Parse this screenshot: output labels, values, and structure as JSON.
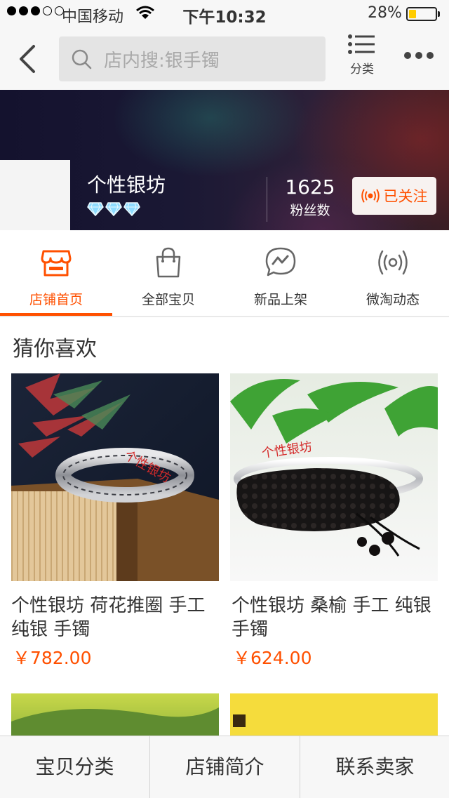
{
  "status_bar": {
    "carrier": "中国移动",
    "time": "下午10:32",
    "battery_pct_text": "28%",
    "battery_level": 0.28,
    "battery_color": "#ffcc00",
    "signal_icon": "signal-dots-icon",
    "wifi_icon": "wifi-icon"
  },
  "nav": {
    "back_icon": "chevron-left-icon",
    "search_placeholder": "店内搜:银手镯",
    "category_label": "分类",
    "more_icon": "more-horizontal-icon"
  },
  "shop": {
    "name": "个性银坊",
    "level_icon": "diamond-icon",
    "level_count": 3,
    "fans_count": "1625",
    "fans_label": "粉丝数",
    "follow_label": "已关注",
    "follow_icon": "broadcast-icon"
  },
  "tabs": [
    {
      "label": "店铺首页",
      "icon": "storefront-icon",
      "active": true
    },
    {
      "label": "全部宝贝",
      "icon": "shopping-bag-icon",
      "active": false
    },
    {
      "label": "新品上架",
      "icon": "lightning-chat-icon",
      "active": false
    },
    {
      "label": "微淘动态",
      "icon": "broadcast-icon",
      "active": false
    }
  ],
  "recommend": {
    "section_title": "猜你喜欢",
    "products": [
      {
        "title": "个性银坊  荷花推圈  手工 纯银 手镯",
        "price": "￥782.00",
        "watermark": "个性银坊"
      },
      {
        "title": "个性银坊  桑榆   手工 纯银手镯",
        "price": "￥624.00",
        "watermark": "个性银坊"
      }
    ]
  },
  "bottom_bar": [
    {
      "label": "宝贝分类"
    },
    {
      "label": "店铺简介"
    },
    {
      "label": "联系卖家"
    }
  ],
  "colors": {
    "accent": "#ff5000",
    "nav_bg": "#f7f7f7"
  }
}
